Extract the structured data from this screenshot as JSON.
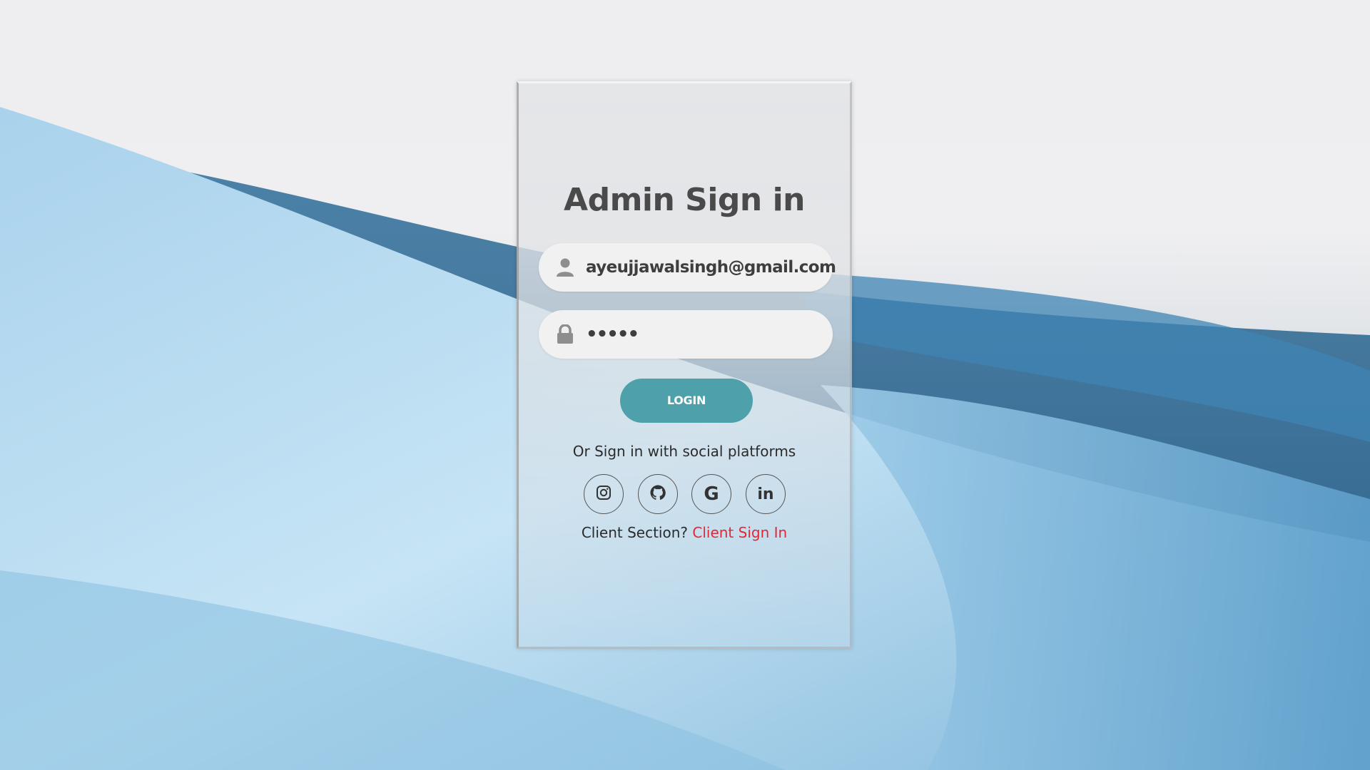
{
  "page": {
    "title": "Admin Sign in"
  },
  "form": {
    "email_value": "ayeujjawalsingh@gmail.com",
    "password_value": "•••••",
    "login_label": "LOGIN"
  },
  "social": {
    "prompt": "Or Sign in with social platforms",
    "platforms": [
      {
        "name": "instagram",
        "icon": "instagram-icon"
      },
      {
        "name": "github",
        "icon": "github-icon"
      },
      {
        "name": "google",
        "icon": "google-icon",
        "glyph": "G"
      },
      {
        "name": "linkedin",
        "icon": "linkedin-icon",
        "glyph": "in"
      }
    ]
  },
  "client": {
    "question": "Client Section?",
    "link_label": "Client Sign In"
  },
  "colors": {
    "accent": "#4ea0aa",
    "link": "#e02836",
    "title": "#4a4a4a"
  }
}
